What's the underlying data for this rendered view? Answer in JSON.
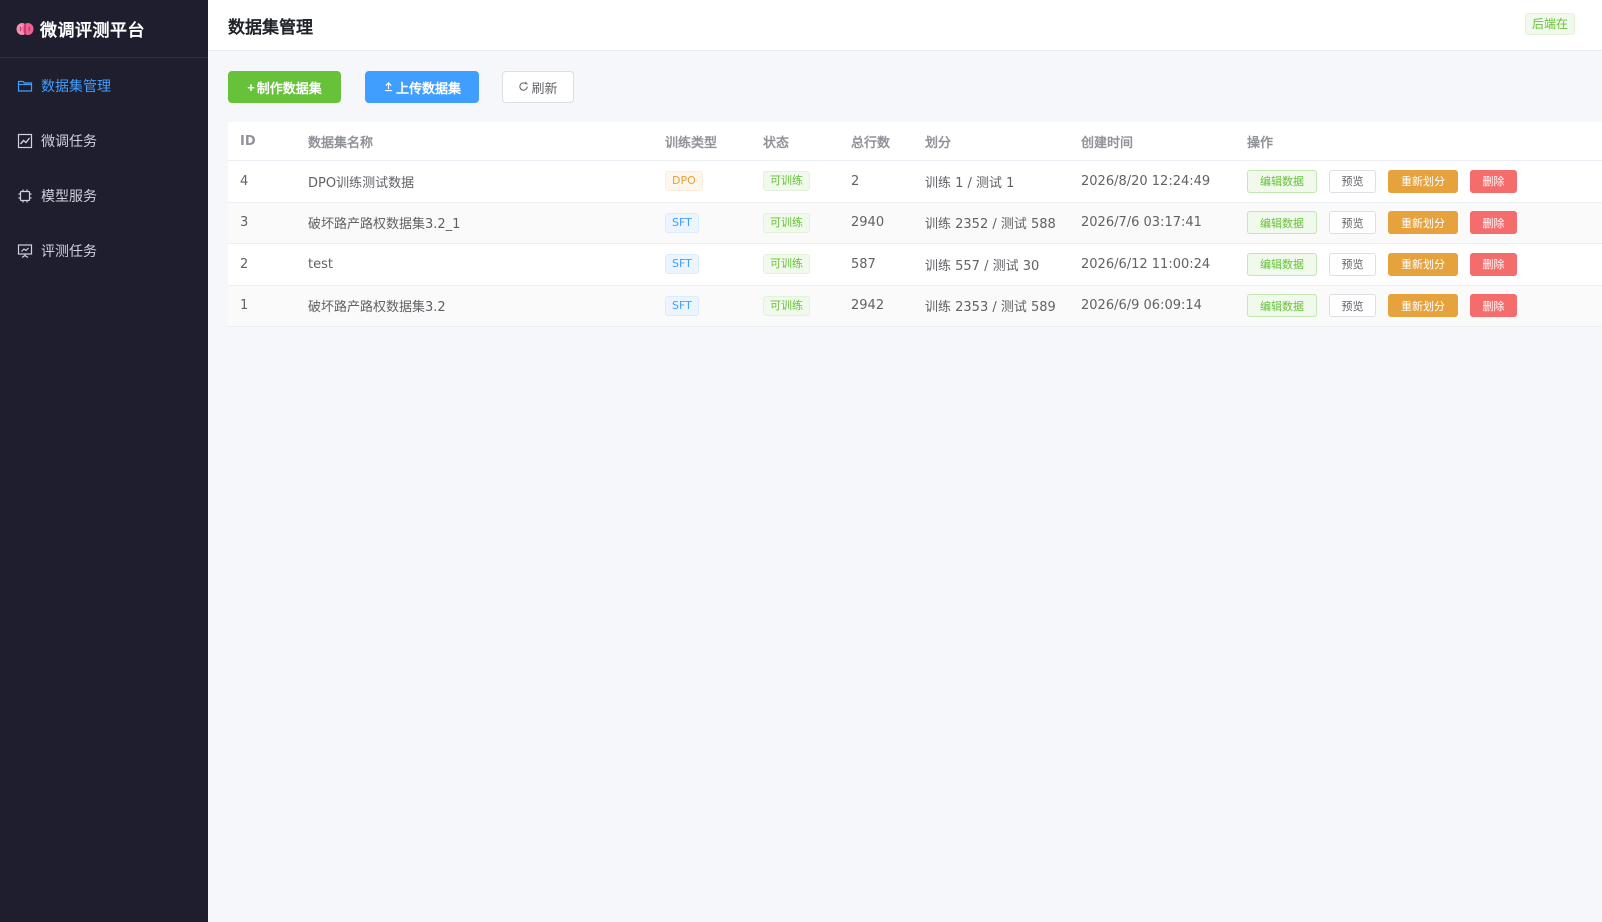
{
  "sidebar": {
    "brand": "微调评测平台",
    "items": [
      {
        "label": "数据集管理",
        "icon": "folder-icon",
        "active": true
      },
      {
        "label": "微调任务",
        "icon": "chart-icon",
        "active": false
      },
      {
        "label": "模型服务",
        "icon": "cpu-icon",
        "active": false
      },
      {
        "label": "评测任务",
        "icon": "presentation-icon",
        "active": false
      }
    ]
  },
  "header": {
    "title": "数据集管理",
    "status": "后端在"
  },
  "toolbar": {
    "create_label": "制作数据集",
    "upload_label": "上传数据集",
    "refresh_label": "刷新"
  },
  "table": {
    "columns": [
      "ID",
      "数据集名称",
      "训练类型",
      "状态",
      "总行数",
      "划分",
      "创建时间",
      "操作"
    ],
    "rows": [
      {
        "id": "4",
        "name": "DPO训练测试数据",
        "type": "DPO",
        "status": "可训练",
        "rows": "2",
        "split": "训练 1 / 测试 1",
        "created": "2026/8/20 12:24:49"
      },
      {
        "id": "3",
        "name": "破坏路产路权数据集3.2_1",
        "type": "SFT",
        "status": "可训练",
        "rows": "2940",
        "split": "训练 2352 / 测试 588",
        "created": "2026/7/6 03:17:41"
      },
      {
        "id": "2",
        "name": "test",
        "type": "SFT",
        "status": "可训练",
        "rows": "587",
        "split": "训练 557 / 测试 30",
        "created": "2026/6/12 11:00:24"
      },
      {
        "id": "1",
        "name": "破坏路产路权数据集3.2",
        "type": "SFT",
        "status": "可训练",
        "rows": "2942",
        "split": "训练 2353 / 测试 589",
        "created": "2026/6/9 06:09:14"
      }
    ],
    "ops": {
      "edit": "编辑数据",
      "preview": "预览",
      "resplit": "重新划分",
      "delete": "删除"
    }
  },
  "colors": {
    "sidebar_bg": "#1e1e2f",
    "accent": "#409eff",
    "success": "#67c23a",
    "warning": "#e6a23c",
    "danger": "#f56c6c"
  }
}
